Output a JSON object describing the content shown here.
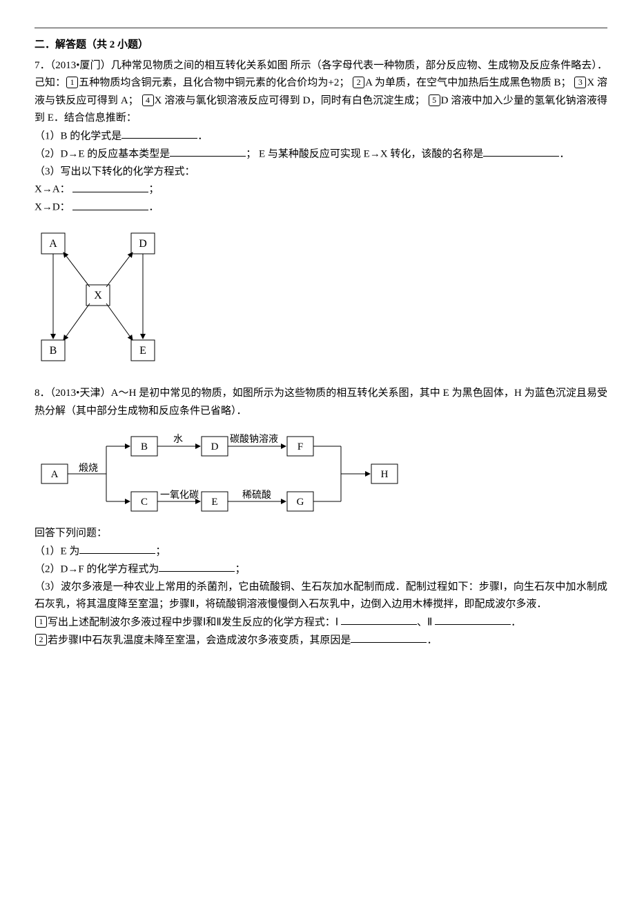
{
  "section_title": "二．解答题（共 2 小题）",
  "q7": {
    "header": "7．（2013•厦门）几种常见物质之间的相互转化关系如图 所示（各字母代表一种物质，部分反应物、生成物及反应条件略去）．己知：",
    "c1": "五种物质均含铜元素，且化合物中铜元素的化合价均为+2； ",
    "c2": "A 为单质，在空气中加热后生成黑色物质 B； ",
    "c3": "X 溶液与铁反应可得到 A； ",
    "c4": "X 溶液与氯化钡溶液反应可得到 D，同时有白色沉淀生成； ",
    "c5": "D 溶液中加入少量的氢氧化钠溶液得到 E．结合信息推断：",
    "p1a": "（1）B 的化学式是",
    "p1b": "．",
    "p2a": "（2）D→E 的反应基本类型是",
    "p2b": "；  E 与某种酸反应可实现 E→X 转化，该酸的名称是",
    "p2c": "．",
    "p3": "（3）写出以下转化的化学方程式：",
    "p3a1": "X→A：",
    "p3a2": "；",
    "p3b1": "X→D：",
    "p3b2": "．",
    "boxA": "A",
    "boxB": "B",
    "boxD": "D",
    "boxE": "E",
    "boxX": "X"
  },
  "q8": {
    "header": "8．（2013•天津）A～H 是初中常见的物质，如图所示为这些物质的相互转化关系图，其中 E 为黑色固体，H 为蓝色沉淀且易受热分解（其中部分生成物和反应条件已省略）．",
    "boxA": "A",
    "boxB": "B",
    "boxC": "C",
    "boxD": "D",
    "boxE": "E",
    "boxF": "F",
    "boxG": "G",
    "boxH": "H",
    "lbl_duan": "煅烧",
    "lbl_water": "水",
    "lbl_co": "一氧化碳",
    "lbl_na2co3": "碳酸钠溶液",
    "lbl_h2so4": "稀硫酸",
    "answer_prompt": "回答下列问题：",
    "p1a": "（1）E 为",
    "p1b": "；",
    "p2a": "（2）D→F 的化学方程式为",
    "p2b": "；",
    "p3": "（3）波尔多液是一种农业上常用的杀菌剂，它由硫酸铜、生石灰加水配制而成．配制过程如下：步骤Ⅰ，向生石灰中加水制成石灰乳，将其温度降至室温；步骤Ⅱ，将硫酸铜溶液慢慢倒入石灰乳中，边倒入边用木棒搅拌，即配成波尔多液．",
    "p3_1a": "写出上述配制波尔多液过程中步骤Ⅰ和Ⅱ发生反应的化学方程式：Ⅰ",
    "p3_1b": "、Ⅱ",
    "p3_1c": "．",
    "p3_2a": "若步骤Ⅰ中石灰乳温度未降至室温，会造成波尔多液变质，其原因是",
    "p3_2b": "．",
    "circ1": "1",
    "circ2": "2",
    "circ3": "3",
    "circ4": "4",
    "circ5": "5"
  }
}
